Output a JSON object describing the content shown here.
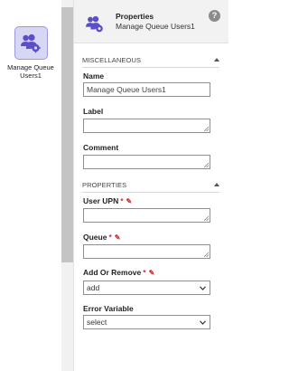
{
  "canvas": {
    "activity": {
      "label": "Manage Queue Users1",
      "icon": "users-gear-icon"
    }
  },
  "panel": {
    "header": {
      "title": "Properties",
      "subtitle": "Manage Queue Users1",
      "help_icon": "?"
    },
    "sections": {
      "miscellaneous": "MISCELLANEOUS",
      "properties": "PROPERTIES"
    },
    "fields": {
      "name": {
        "label": "Name",
        "value": "Manage Queue Users1"
      },
      "label": {
        "label": "Label",
        "value": ""
      },
      "comment": {
        "label": "Comment",
        "value": ""
      },
      "user_upn": {
        "label": "User UPN",
        "required": "*",
        "value": ""
      },
      "queue": {
        "label": "Queue",
        "required": "*",
        "value": ""
      },
      "add_or_remove": {
        "label": "Add Or Remove",
        "required": "*",
        "selected": "add"
      },
      "error_variable": {
        "label": "Error Variable",
        "selected": "select"
      }
    }
  },
  "colors": {
    "accent_purple": "#5a4fc9",
    "required_red": "#d32f2f",
    "icon_bg": "#d6d6f5"
  }
}
